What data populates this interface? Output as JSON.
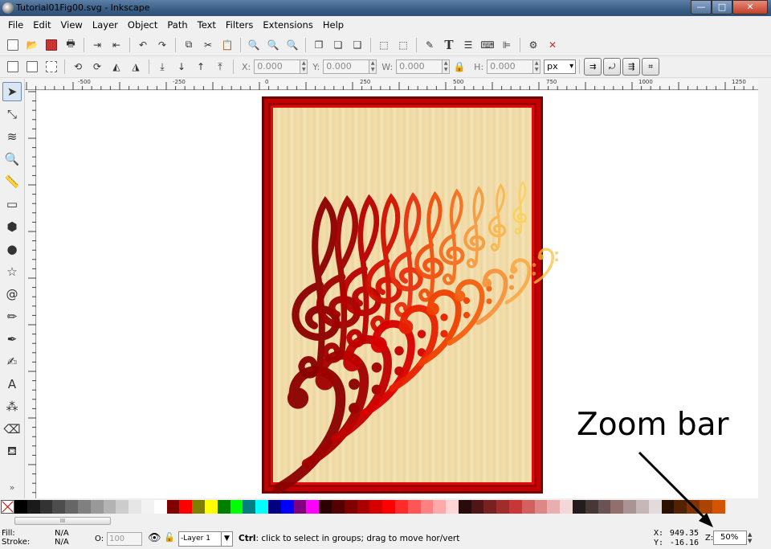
{
  "window": {
    "title": "Tutorial01Fig00.svg - Inkscape",
    "minimize": "—",
    "maximize": "□",
    "close": "✕"
  },
  "menu": [
    "File",
    "Edit",
    "View",
    "Layer",
    "Object",
    "Path",
    "Text",
    "Filters",
    "Extensions",
    "Help"
  ],
  "selector_toolbar": {
    "x_label": "X:",
    "x_value": "0.000",
    "y_label": "Y:",
    "y_value": "0.000",
    "w_label": "W:",
    "w_value": "0.000",
    "h_label": "H:",
    "h_value": "0.000",
    "unit": "px"
  },
  "ruler": {
    "labels": [
      "-500",
      "-250",
      "0",
      "250",
      "500",
      "750",
      "1000",
      "1250"
    ]
  },
  "palette": {
    "colors": [
      "#000000",
      "#1a1a1a",
      "#333333",
      "#4d4d4d",
      "#666666",
      "#808080",
      "#999999",
      "#b3b3b3",
      "#cccccc",
      "#e6e6e6",
      "#f2f2f2",
      "#ffffff",
      "#800000",
      "#ff0000",
      "#808000",
      "#ffff00",
      "#008000",
      "#00ff00",
      "#008080",
      "#00ffff",
      "#000080",
      "#0000ff",
      "#800080",
      "#ff00ff",
      "#2b0000",
      "#550000",
      "#800000",
      "#aa0000",
      "#d40000",
      "#ff0000",
      "#ff2a2a",
      "#ff5555",
      "#ff8080",
      "#ffaaaa",
      "#ffd5d5",
      "#280b0b",
      "#501616",
      "#782121",
      "#a02c2c",
      "#c83737",
      "#d35f5f",
      "#de8787",
      "#e9afaf",
      "#f4d7d7",
      "#241c1c",
      "#483737",
      "#6c5353",
      "#916f6f",
      "#ac9393",
      "#c8b7b7",
      "#e3dbdb",
      "#2b1100",
      "#552200",
      "#803300",
      "#aa4400",
      "#d45500"
    ]
  },
  "status": {
    "fill_label": "Fill:",
    "fill_value": "N/A",
    "stroke_label": "Stroke:",
    "stroke_value": "N/A",
    "opacity_label": "O:",
    "opacity_value": "100",
    "layer": "-Layer 1",
    "message_bold": "Ctrl",
    "message": ": click to select in groups; drag to move hor/vert",
    "x_label": "X:",
    "x_value": "949.35",
    "y_label": "Y:",
    "y_value": "-16.16",
    "zoom_label": "Z:",
    "zoom_value": "50%"
  },
  "annotation": {
    "text": "Zoom bar"
  },
  "scroll_thumb": "III",
  "tools_more": "»"
}
